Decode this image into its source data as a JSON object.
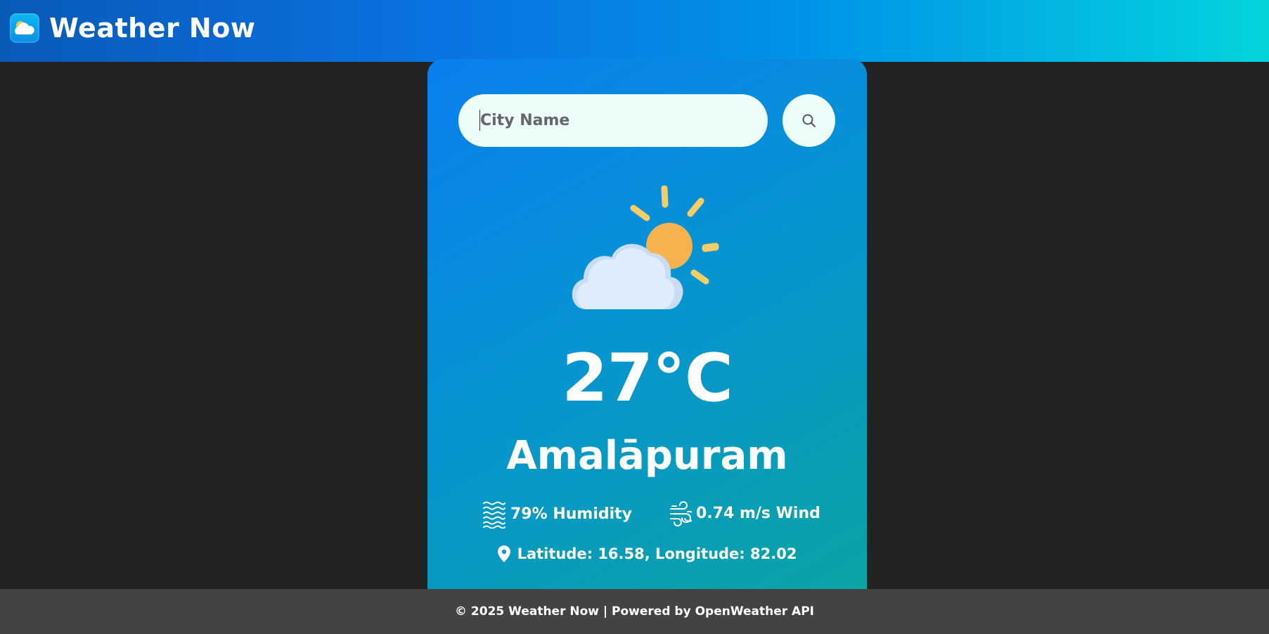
{
  "header": {
    "title": "Weather Now",
    "logo_icon": "cloud-sun-logo-icon"
  },
  "search": {
    "placeholder": "City Name",
    "value": "",
    "button_icon": "search-icon"
  },
  "weather": {
    "condition_icon": "partly-cloudy-icon",
    "temperature": "27°C",
    "city": "Amalāpuram",
    "humidity_text": "79% Humidity",
    "wind_text": "0.74 m/s Wind",
    "coordinates_text": "Latitude: 16.58, Longitude: 82.02"
  },
  "footer": {
    "text": "© 2025 Weather Now | Powered by OpenWeather API"
  },
  "colors": {
    "header_start": "#0a5ab8",
    "header_end": "#03d4dc",
    "card_top": "#0a7ff0",
    "card_bottom": "#0aa4a4",
    "page_bg": "#232323",
    "footer_bg": "#434343",
    "sun": "#f7b250",
    "cloud": "#dcebfb"
  }
}
